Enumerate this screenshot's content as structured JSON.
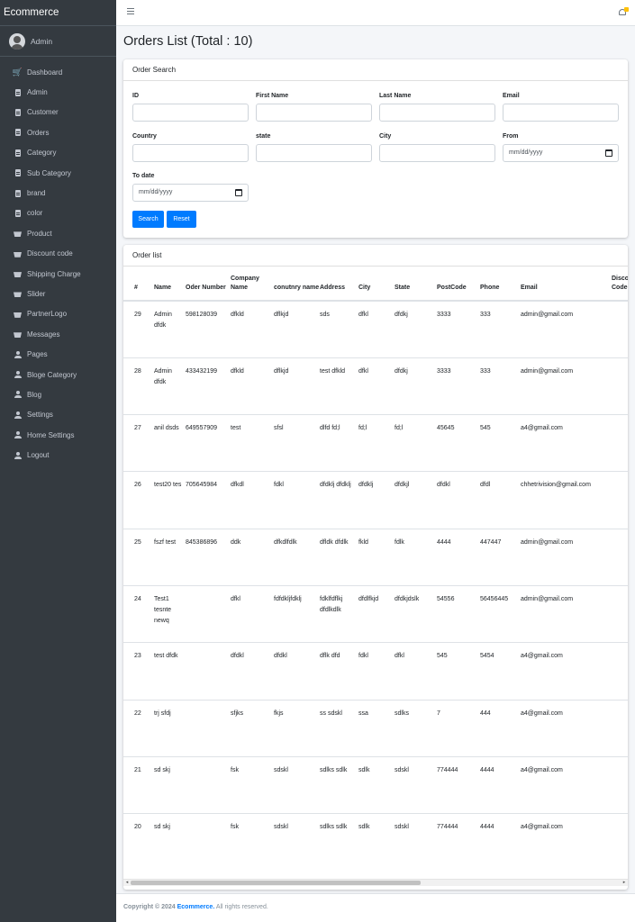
{
  "sidebar": {
    "brand": "Ecommerce",
    "user": "Admin",
    "items": [
      {
        "label": "Dashboard",
        "icon": "cart-icon"
      },
      {
        "label": "Admin",
        "icon": "file-icon"
      },
      {
        "label": "Customer",
        "icon": "file-icon"
      },
      {
        "label": "Orders",
        "icon": "file-icon"
      },
      {
        "label": "Category",
        "icon": "file-icon"
      },
      {
        "label": "Sub Category",
        "icon": "file-icon"
      },
      {
        "label": "brand",
        "icon": "file-icon"
      },
      {
        "label": "color",
        "icon": "file-icon"
      },
      {
        "label": "Product",
        "icon": "basket-icon"
      },
      {
        "label": "Discount code",
        "icon": "basket-icon"
      },
      {
        "label": "Shipping Charge",
        "icon": "basket-icon"
      },
      {
        "label": "Slider",
        "icon": "basket-icon"
      },
      {
        "label": "PartnerLogo",
        "icon": "basket-icon"
      },
      {
        "label": "Messages",
        "icon": "basket-icon"
      },
      {
        "label": "Pages",
        "icon": "user-icon"
      },
      {
        "label": "Bloge Category",
        "icon": "user-icon"
      },
      {
        "label": "Blog",
        "icon": "user-icon"
      },
      {
        "label": "Settings",
        "icon": "user-icon"
      },
      {
        "label": "Home Settings",
        "icon": "user-icon"
      },
      {
        "label": "Logout",
        "icon": "user-icon"
      }
    ]
  },
  "page": {
    "title": "Orders List (Total : 10)"
  },
  "search": {
    "header": "Order Search",
    "id_label": "ID",
    "first_name_label": "First Name",
    "last_name_label": "Last Name",
    "email_label": "Email",
    "country_label": "Country",
    "state_label": "state",
    "city_label": "City",
    "from_label": "From",
    "from_placeholder": "mm/dd/yyyy",
    "to_label": "To date",
    "to_placeholder": "mm/dd/yyyy",
    "search_button": "Search",
    "reset_button": "Reset"
  },
  "orders": {
    "header": "Order list",
    "columns": [
      "#",
      "Name",
      "Oder Number",
      "Company Name",
      "conutnry name",
      "Address",
      "City",
      "State",
      "PostCode",
      "Phone",
      "Email",
      "Discount Code"
    ],
    "rows": [
      [
        "29",
        "Admin dfdk",
        "598128039",
        "dfkld",
        "dflkjd",
        "sds",
        "dfkl",
        "dfdkj",
        "3333",
        "333",
        "admin@gmail.com",
        ""
      ],
      [
        "28",
        "Admin dfdk",
        "433432199",
        "dfkld",
        "dflkjd",
        "test dfkld",
        "dfkl",
        "dfdkj",
        "3333",
        "333",
        "admin@gmail.com",
        ""
      ],
      [
        "27",
        "anil dsds",
        "649557909",
        "test",
        "sfsl",
        "dlfd fd;l",
        "fd;l",
        "fd;l",
        "45645",
        "545",
        "a4@gmail.com",
        ""
      ],
      [
        "26",
        "test20 tes",
        "705645984",
        "dfkdl",
        "fdkl",
        "dfdklj dfdklj",
        "dfdklj",
        "dfdkjl",
        "dfdkl",
        "dfdl",
        "chhetrivision@gmail.com",
        ""
      ],
      [
        "25",
        "fszf test",
        "845386896",
        "ddk",
        "dfkdlfdlk",
        "dfldk dfdlk",
        "fkld",
        "fdlk",
        "4444",
        "447447",
        "admin@gmail.com",
        ""
      ],
      [
        "24",
        "Test1 tesnte newq",
        "",
        "dfkl",
        "fdfdkljfdklj",
        "fdklfdflkj dfdlkdlk",
        "dfdlfkjd",
        "dfdkjdslk",
        "54556",
        "56456445",
        "admin@gmail.com",
        ""
      ],
      [
        "23",
        "test dfdk",
        "",
        "dfdkl",
        "dfdkl",
        "dflk dfd",
        "fdkl",
        "dfkl",
        "545",
        "5454",
        "a4@gmail.com",
        ""
      ],
      [
        "22",
        "trj sfdj",
        "",
        "sfjks",
        "fkjs",
        "ss sdskl",
        "ssa",
        "sdlks",
        "7",
        "444",
        "a4@gmail.com",
        ""
      ],
      [
        "21",
        "sd skj",
        "",
        "fsk",
        "sdskl",
        "sdlks sdlk",
        "sdlk",
        "sdskl",
        "774444",
        "4444",
        "a4@gmail.com",
        ""
      ],
      [
        "20",
        "sd skj",
        "",
        "fsk",
        "sdskl",
        "sdlks sdlk",
        "sdlk",
        "sdskl",
        "774444",
        "4444",
        "a4@gmail.com",
        ""
      ]
    ]
  },
  "footer": {
    "prefix": "Copyright © 2024",
    "brand": "Ecommerce.",
    "suffix": " All rights reserved."
  },
  "colors": {
    "sidebar_bg": "#343a40",
    "primary": "#007bff",
    "notification_badge": "#ffc107"
  }
}
